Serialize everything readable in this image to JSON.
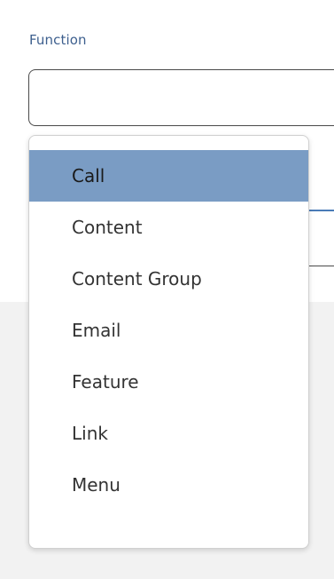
{
  "field": {
    "label": "Function",
    "value": ""
  },
  "dropdown": {
    "selected_index": 0,
    "options": [
      {
        "label": "Call"
      },
      {
        "label": "Content"
      },
      {
        "label": "Content Group"
      },
      {
        "label": "Email"
      },
      {
        "label": "Feature"
      },
      {
        "label": "Link"
      },
      {
        "label": "Menu"
      }
    ]
  },
  "colors": {
    "label": "#3d5f8e",
    "selected_bg": "#7a9cc4",
    "border": "#4a4a4a"
  }
}
